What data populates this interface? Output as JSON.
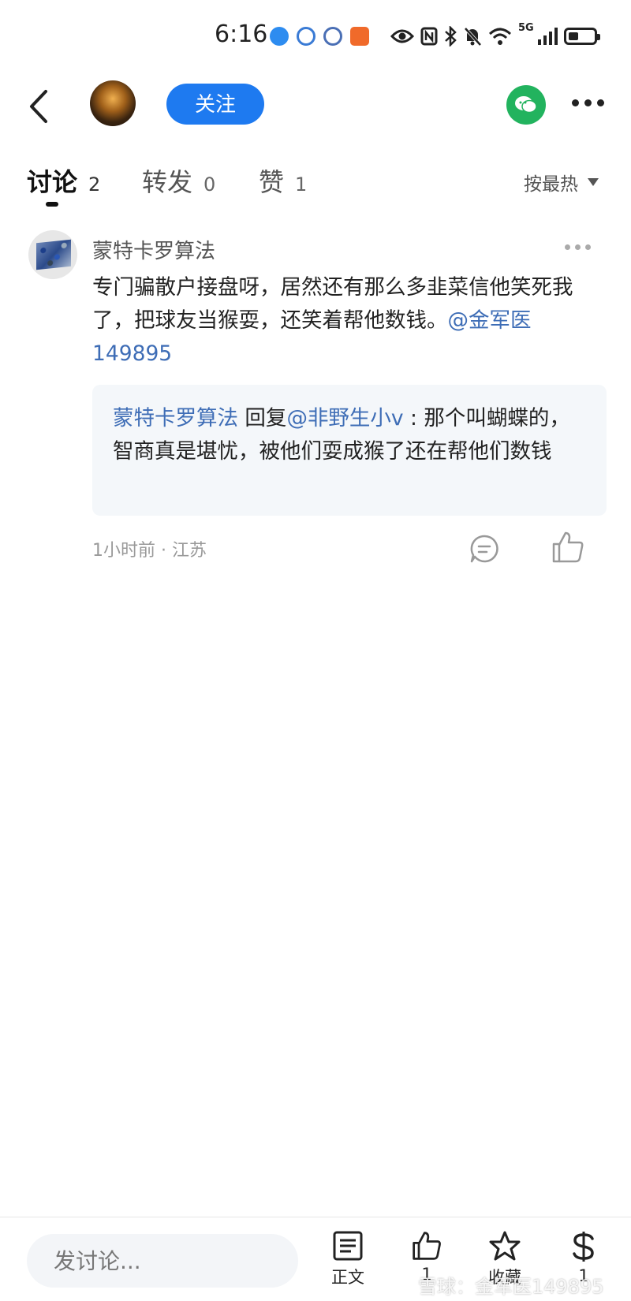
{
  "status_bar": {
    "time": "6:16",
    "network": "5G"
  },
  "header": {
    "follow_label": "关注"
  },
  "tabs": [
    {
      "label": "讨论",
      "count": "2"
    },
    {
      "label": "转发",
      "count": "0"
    },
    {
      "label": "赞",
      "count": "1"
    }
  ],
  "sort_label": "按最热",
  "post": {
    "author": "蒙特卡罗算法",
    "text": "专门骗散户接盘呀，居然还有那么多韭菜信他笑死我了，把球友当猴耍，还笑着帮他数钱。",
    "mention": "@金军医149895",
    "reply": {
      "author": "蒙特卡罗算法",
      "reply_word": " 回复",
      "target": "@非野生小v",
      "text": " : 那个叫蝴蝶的，智商真是堪忧，被他们耍成猴了还在帮他们数钱"
    },
    "time": "1小时前",
    "location": "江苏",
    "meta_sep": " · "
  },
  "bottom_bar": {
    "input_placeholder": "发讨论...",
    "article_label": "正文",
    "like_count": "1",
    "favorite_label": "收藏",
    "reward_count": "1"
  },
  "watermark": "雪球：金军医149895",
  "icons": [
    "back-arrow-icon",
    "wechat-icon",
    "more-icon",
    "comment-icon",
    "like-icon",
    "article-icon",
    "star-icon",
    "dollar-icon"
  ],
  "colors": {
    "accent": "#1e7af0",
    "mention": "#3e6db6",
    "wechat": "#22b35e"
  }
}
